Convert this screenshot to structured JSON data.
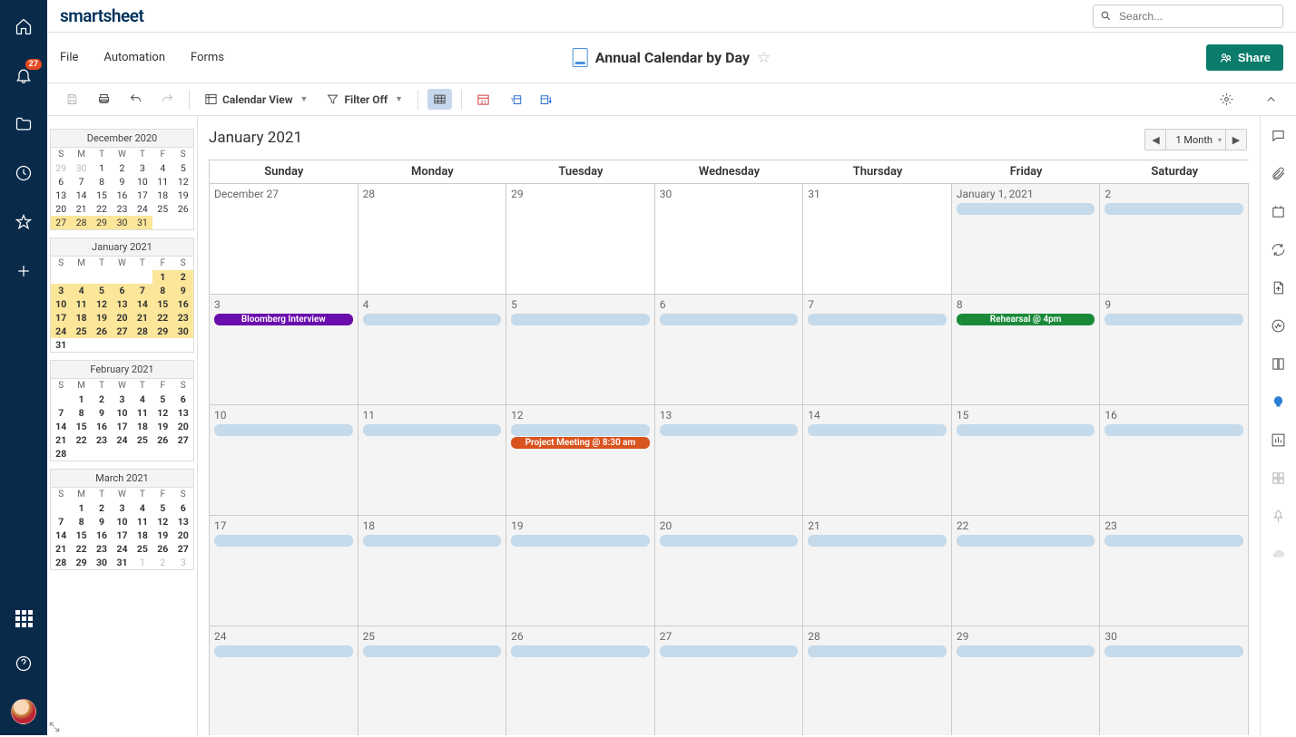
{
  "logo": "smartsheet",
  "search": {
    "placeholder": "Search..."
  },
  "notifications": {
    "count": "27"
  },
  "menu": {
    "file": "File",
    "automation": "Automation",
    "forms": "Forms"
  },
  "doc": {
    "title": "Annual Calendar by Day"
  },
  "share_label": "Share",
  "toolbar": {
    "view_label": "Calendar View",
    "filter_label": "Filter Off"
  },
  "period_title": "January 2021",
  "range_label": "1 Month",
  "day_headers": [
    "Sunday",
    "Monday",
    "Tuesday",
    "Wednesday",
    "Thursday",
    "Friday",
    "Saturday"
  ],
  "mini_day_short": [
    "S",
    "M",
    "T",
    "W",
    "T",
    "F",
    "S"
  ],
  "mini_months": [
    {
      "title": "December 2020",
      "rows": [
        [
          {
            "d": "29",
            "o": 1
          },
          {
            "d": "30",
            "o": 1
          },
          {
            "d": "1"
          },
          {
            "d": "2"
          },
          {
            "d": "3"
          },
          {
            "d": "4"
          },
          {
            "d": "5"
          }
        ],
        [
          {
            "d": "6"
          },
          {
            "d": "7"
          },
          {
            "d": "8"
          },
          {
            "d": "9"
          },
          {
            "d": "10"
          },
          {
            "d": "11"
          },
          {
            "d": "12"
          }
        ],
        [
          {
            "d": "13"
          },
          {
            "d": "14"
          },
          {
            "d": "15"
          },
          {
            "d": "16"
          },
          {
            "d": "17"
          },
          {
            "d": "18"
          },
          {
            "d": "19"
          }
        ],
        [
          {
            "d": "20"
          },
          {
            "d": "21"
          },
          {
            "d": "22"
          },
          {
            "d": "23"
          },
          {
            "d": "24"
          },
          {
            "d": "25"
          },
          {
            "d": "26"
          }
        ],
        [
          {
            "d": "27",
            "h": 1
          },
          {
            "d": "28",
            "h": 1
          },
          {
            "d": "29",
            "h": 1
          },
          {
            "d": "30",
            "h": 1
          },
          {
            "d": "31",
            "h": 1
          },
          {
            "d": ""
          },
          {
            "d": ""
          }
        ]
      ]
    },
    {
      "title": "January 2021",
      "rows": [
        [
          {
            "d": ""
          },
          {
            "d": ""
          },
          {
            "d": ""
          },
          {
            "d": ""
          },
          {
            "d": ""
          },
          {
            "d": "1",
            "h": 1,
            "b": 1
          },
          {
            "d": "2",
            "h": 1,
            "b": 1
          }
        ],
        [
          {
            "d": "3",
            "h": 1,
            "b": 1
          },
          {
            "d": "4",
            "h": 1,
            "b": 1
          },
          {
            "d": "5",
            "h": 1,
            "b": 1
          },
          {
            "d": "6",
            "h": 1,
            "b": 1
          },
          {
            "d": "7",
            "h": 1,
            "b": 1
          },
          {
            "d": "8",
            "h": 1,
            "b": 1
          },
          {
            "d": "9",
            "h": 1,
            "b": 1
          }
        ],
        [
          {
            "d": "10",
            "h": 1,
            "b": 1
          },
          {
            "d": "11",
            "h": 1,
            "b": 1
          },
          {
            "d": "12",
            "h": 1,
            "b": 1
          },
          {
            "d": "13",
            "h": 1,
            "b": 1
          },
          {
            "d": "14",
            "h": 1,
            "b": 1
          },
          {
            "d": "15",
            "h": 1,
            "b": 1
          },
          {
            "d": "16",
            "h": 1,
            "b": 1
          }
        ],
        [
          {
            "d": "17",
            "h": 1,
            "b": 1
          },
          {
            "d": "18",
            "h": 1,
            "b": 1
          },
          {
            "d": "19",
            "h": 1,
            "b": 1
          },
          {
            "d": "20",
            "h": 1,
            "b": 1
          },
          {
            "d": "21",
            "h": 1,
            "b": 1
          },
          {
            "d": "22",
            "h": 1,
            "b": 1
          },
          {
            "d": "23",
            "h": 1,
            "b": 1
          }
        ],
        [
          {
            "d": "24",
            "h": 1,
            "b": 1
          },
          {
            "d": "25",
            "h": 1,
            "b": 1
          },
          {
            "d": "26",
            "h": 1,
            "b": 1
          },
          {
            "d": "27",
            "h": 1,
            "b": 1
          },
          {
            "d": "28",
            "h": 1,
            "b": 1
          },
          {
            "d": "29",
            "h": 1,
            "b": 1
          },
          {
            "d": "30",
            "h": 1,
            "b": 1
          }
        ],
        [
          {
            "d": "31",
            "b": 1
          },
          {
            "d": ""
          },
          {
            "d": ""
          },
          {
            "d": ""
          },
          {
            "d": ""
          },
          {
            "d": ""
          },
          {
            "d": ""
          }
        ]
      ]
    },
    {
      "title": "February 2021",
      "rows": [
        [
          {
            "d": ""
          },
          {
            "d": "1",
            "b": 1
          },
          {
            "d": "2",
            "b": 1
          },
          {
            "d": "3",
            "b": 1
          },
          {
            "d": "4",
            "b": 1
          },
          {
            "d": "5",
            "b": 1
          },
          {
            "d": "6",
            "b": 1
          }
        ],
        [
          {
            "d": "7",
            "b": 1
          },
          {
            "d": "8",
            "b": 1
          },
          {
            "d": "9",
            "b": 1
          },
          {
            "d": "10",
            "b": 1
          },
          {
            "d": "11",
            "b": 1
          },
          {
            "d": "12",
            "b": 1
          },
          {
            "d": "13",
            "b": 1
          }
        ],
        [
          {
            "d": "14",
            "b": 1
          },
          {
            "d": "15",
            "b": 1
          },
          {
            "d": "16",
            "b": 1
          },
          {
            "d": "17",
            "b": 1
          },
          {
            "d": "18",
            "b": 1
          },
          {
            "d": "19",
            "b": 1
          },
          {
            "d": "20",
            "b": 1
          }
        ],
        [
          {
            "d": "21",
            "b": 1
          },
          {
            "d": "22",
            "b": 1
          },
          {
            "d": "23",
            "b": 1
          },
          {
            "d": "24",
            "b": 1
          },
          {
            "d": "25",
            "b": 1
          },
          {
            "d": "26",
            "b": 1
          },
          {
            "d": "27",
            "b": 1
          }
        ],
        [
          {
            "d": "28",
            "b": 1
          },
          {
            "d": ""
          },
          {
            "d": ""
          },
          {
            "d": ""
          },
          {
            "d": ""
          },
          {
            "d": ""
          },
          {
            "d": ""
          }
        ]
      ]
    },
    {
      "title": "March 2021",
      "rows": [
        [
          {
            "d": ""
          },
          {
            "d": "1",
            "b": 1
          },
          {
            "d": "2",
            "b": 1
          },
          {
            "d": "3",
            "b": 1
          },
          {
            "d": "4",
            "b": 1
          },
          {
            "d": "5",
            "b": 1
          },
          {
            "d": "6",
            "b": 1
          }
        ],
        [
          {
            "d": "7",
            "b": 1
          },
          {
            "d": "8",
            "b": 1
          },
          {
            "d": "9",
            "b": 1
          },
          {
            "d": "10",
            "b": 1
          },
          {
            "d": "11",
            "b": 1
          },
          {
            "d": "12",
            "b": 1
          },
          {
            "d": "13",
            "b": 1
          }
        ],
        [
          {
            "d": "14",
            "b": 1
          },
          {
            "d": "15",
            "b": 1
          },
          {
            "d": "16",
            "b": 1
          },
          {
            "d": "17",
            "b": 1
          },
          {
            "d": "18",
            "b": 1
          },
          {
            "d": "19",
            "b": 1
          },
          {
            "d": "20",
            "b": 1
          }
        ],
        [
          {
            "d": "21",
            "b": 1
          },
          {
            "d": "22",
            "b": 1
          },
          {
            "d": "23",
            "b": 1
          },
          {
            "d": "24",
            "b": 1
          },
          {
            "d": "25",
            "b": 1
          },
          {
            "d": "26",
            "b": 1
          },
          {
            "d": "27",
            "b": 1
          }
        ],
        [
          {
            "d": "28",
            "b": 1
          },
          {
            "d": "29",
            "b": 1
          },
          {
            "d": "30",
            "b": 1
          },
          {
            "d": "31",
            "b": 1
          },
          {
            "d": "1",
            "o": 1
          },
          {
            "d": "2",
            "o": 1
          },
          {
            "d": "3",
            "o": 1
          }
        ]
      ]
    }
  ],
  "events": {
    "bloomberg": "Bloomberg Interview",
    "rehearsal": "Rehearsal @ 4pm",
    "project": "Project Meeting @ 8:30 am"
  },
  "cells": [
    {
      "label": "December 27",
      "white": 1,
      "bars": []
    },
    {
      "label": "28",
      "white": 1,
      "bars": []
    },
    {
      "label": "29",
      "white": 1,
      "bars": []
    },
    {
      "label": "30",
      "white": 1,
      "bars": []
    },
    {
      "label": "31",
      "white": 1,
      "bars": []
    },
    {
      "label": "January 1, 2021",
      "bars": [
        {
          "type": "empty"
        }
      ]
    },
    {
      "label": "2",
      "bars": [
        {
          "type": "empty"
        }
      ]
    },
    {
      "label": "3",
      "bars": [
        {
          "type": "purple",
          "text": "bloomberg"
        }
      ]
    },
    {
      "label": "4",
      "bars": [
        {
          "type": "empty"
        }
      ]
    },
    {
      "label": "5",
      "bars": [
        {
          "type": "empty"
        }
      ]
    },
    {
      "label": "6",
      "bars": [
        {
          "type": "empty"
        }
      ]
    },
    {
      "label": "7",
      "bars": [
        {
          "type": "empty"
        }
      ]
    },
    {
      "label": "8",
      "bars": [
        {
          "type": "green",
          "text": "rehearsal"
        }
      ]
    },
    {
      "label": "9",
      "bars": [
        {
          "type": "empty"
        }
      ]
    },
    {
      "label": "10",
      "bars": [
        {
          "type": "empty"
        }
      ]
    },
    {
      "label": "11",
      "bars": [
        {
          "type": "empty"
        }
      ]
    },
    {
      "label": "12",
      "bars": [
        {
          "type": "empty"
        },
        {
          "type": "orange",
          "text": "project"
        }
      ]
    },
    {
      "label": "13",
      "bars": [
        {
          "type": "empty"
        }
      ]
    },
    {
      "label": "14",
      "bars": [
        {
          "type": "empty"
        }
      ]
    },
    {
      "label": "15",
      "bars": [
        {
          "type": "empty"
        }
      ]
    },
    {
      "label": "16",
      "bars": [
        {
          "type": "empty"
        }
      ]
    },
    {
      "label": "17",
      "bars": [
        {
          "type": "empty"
        }
      ]
    },
    {
      "label": "18",
      "bars": [
        {
          "type": "empty"
        }
      ]
    },
    {
      "label": "19",
      "bars": [
        {
          "type": "empty"
        }
      ]
    },
    {
      "label": "20",
      "bars": [
        {
          "type": "empty"
        }
      ]
    },
    {
      "label": "21",
      "bars": [
        {
          "type": "empty"
        }
      ]
    },
    {
      "label": "22",
      "bars": [
        {
          "type": "empty"
        }
      ]
    },
    {
      "label": "23",
      "bars": [
        {
          "type": "empty"
        }
      ]
    },
    {
      "label": "24",
      "bars": [
        {
          "type": "empty"
        }
      ]
    },
    {
      "label": "25",
      "bars": [
        {
          "type": "empty"
        }
      ]
    },
    {
      "label": "26",
      "bars": [
        {
          "type": "empty"
        }
      ]
    },
    {
      "label": "27",
      "bars": [
        {
          "type": "empty"
        }
      ]
    },
    {
      "label": "28",
      "bars": [
        {
          "type": "empty"
        }
      ]
    },
    {
      "label": "29",
      "bars": [
        {
          "type": "empty"
        }
      ]
    },
    {
      "label": "30",
      "bars": [
        {
          "type": "empty"
        }
      ]
    }
  ]
}
